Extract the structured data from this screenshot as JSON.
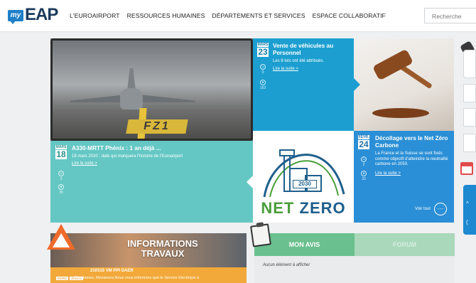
{
  "header": {
    "logo_my": "my",
    "logo_eap": "EAP",
    "nav": [
      "L'EUROAIRPORT",
      "RESSOURCES HUMAINES",
      "DÉPARTEMENTS ET SERVICES",
      "ESPACE COLLABORATIF"
    ],
    "search_placeholder": "Recherche"
  },
  "news": {
    "a330": {
      "month": "MARS",
      "day": "18",
      "title": "A330-MRTT Phénix : 1 an déjà ...",
      "desc": "18 mars 2020 : date qui marquera l'histoire de l'Euroairport",
      "more": "Lire la suite >",
      "likes": "3",
      "views": "35"
    },
    "vente": {
      "month": "MARS",
      "day": "23",
      "title": "Vente de véhicules au Personnel",
      "desc": "Les 8 lots ont été attribués.",
      "more": "Lire la suite >",
      "likes": "0",
      "views": "163"
    },
    "decollage": {
      "month": "FÉVR.",
      "day": "24",
      "title": "Décollage vers le Net Zéro Carbone",
      "desc": "La France et la Suisse se sont fixés comme objectif d'atteindre la neutralité carbone en 2050.",
      "more": "Lire la suite >",
      "likes": "2",
      "views": "33"
    },
    "netzero": {
      "year": "2030",
      "net": "NET",
      "zero": "ZERO"
    },
    "voir_tout": "Voir tout",
    "voir_dots": "···"
  },
  "info_card": {
    "title_line1": "INFORMATIONS",
    "title_line2": "TRAVAUX",
    "ref": "210315 VM PPI DAER",
    "pill1": "MARS",
    "pill2": "JOURS",
    "excerpt": "Mesdames, Messieurs,Nous vous informons que le Service Electrique a"
  },
  "avis_card": {
    "tab_active": "MON AVIS",
    "tab_other": "FORUM",
    "empty": "Aucun élément à afficher"
  },
  "side": {
    "arrow_up": "^",
    "help": "("
  },
  "colors": {
    "teal": "#64c7c4",
    "blue": "#1c9fd0",
    "darkblue": "#2a8fd6",
    "green": "#6ac08e",
    "orange": "#f2a93a"
  }
}
